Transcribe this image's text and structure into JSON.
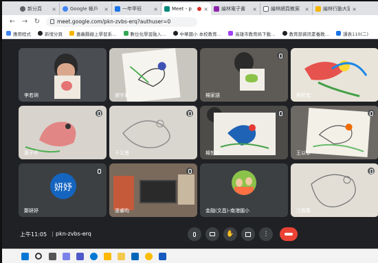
{
  "tabs": [
    {
      "label": "新分頁",
      "favicon_color": "#5f6368"
    },
    {
      "label": "Google 帳戶",
      "favicon_color": "#4285f4"
    },
    {
      "label": "一年甲班",
      "favicon_color": "#1a73e8"
    },
    {
      "label": "Meet - p",
      "favicon_color": "#00897b",
      "active": true
    },
    {
      "label": "繪林電子書",
      "favicon_color": "#8e24aa"
    },
    {
      "label": "繪林網頁教案",
      "favicon_color": "#5f6368"
    },
    {
      "label": "繪林行動大頭網",
      "favicon_color": "#f4b400"
    }
  ],
  "tab_close_glyph": "×",
  "address": "meet.google.com/pkn-zvbs-erq?authuser=0",
  "bookmarks": [
    {
      "label": "應用程式",
      "color": "#4285f4"
    },
    {
      "label": "新增分頁",
      "color": "#202124"
    },
    {
      "label": "嘉義縣線上學習系…",
      "color": "#f4b400"
    },
    {
      "label": "數位化學習融入…",
      "color": "#34a853"
    },
    {
      "label": "中華國小 本校教育…",
      "color": "#202124"
    },
    {
      "label": "高雄市教育局下載…",
      "color": "#a142f4"
    },
    {
      "label": "教育部資訊素養教…",
      "color": "#202124"
    },
    {
      "label": "課表110(二)",
      "color": "#1a73e8"
    }
  ],
  "participants": [
    {
      "name": "李若琍"
    },
    {
      "name": "謝宇辰"
    },
    {
      "name": "楊家語"
    },
    {
      "name": "劉祈宏"
    },
    {
      "name": "黃子亭"
    },
    {
      "name": "于又恩"
    },
    {
      "name": "楊哲文"
    },
    {
      "name": "王以寧"
    },
    {
      "name": "鄭妍妤",
      "avatar_text": "妍妤"
    },
    {
      "name": "張睿昀"
    },
    {
      "name": "金融(文昌)-南港國小"
    },
    {
      "name": "江宥蓁"
    }
  ],
  "bottom_bar": {
    "time": "上午11:05",
    "meeting_code": "pkn-zvbs-erq"
  },
  "colors": {
    "meet_bg": "#202124",
    "tile_bg": "#3c4043",
    "end_call": "#ea4335",
    "avatar": "#1565c0"
  }
}
